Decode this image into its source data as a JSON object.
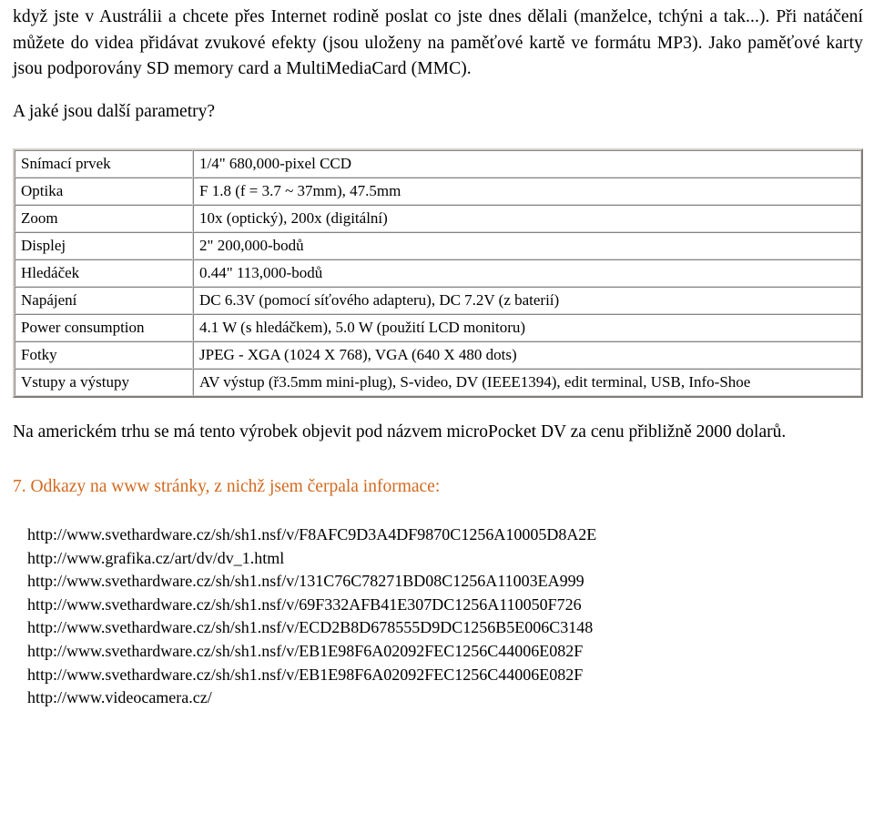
{
  "document": {
    "intro_paragraph": "když jste v Austrálii a chcete přes Internet rodině poslat co jste dnes dělali (manželce, tchýni a tak...). Při natáčení můžete do videa přidávat zvukové efekty (jsou uloženy na paměťové kartě ve formátu MP3). Jako paměťové karty jsou podporovány SD memory card a MultiMediaCard (MMC).",
    "question_line": "A jaké jsou další parametry?",
    "closing_paragraph": "Na americkém trhu se má tento výrobek objevit pod názvem microPocket DV za cenu přibližně 2000 dolarů.",
    "section_heading": "7. Odkazy na www stránky, z nichž jsem čerpala informace:",
    "heading_color": "#d2691e"
  },
  "spec_table": {
    "rows": [
      {
        "label": "Snímací prvek",
        "value": "1/4\" 680,000-pixel CCD"
      },
      {
        "label": "Optika",
        "value": "F 1.8 (f = 3.7 ~ 37mm), 47.5mm"
      },
      {
        "label": "Zoom",
        "value": "10x (optický), 200x (digitální)"
      },
      {
        "label": "Displej",
        "value": "2\" 200,000-bodů"
      },
      {
        "label": "Hledáček",
        "value": "0.44\" 113,000-bodů"
      },
      {
        "label": "Napájení",
        "value": "DC 6.3V (pomocí síťového adapteru), DC 7.2V (z baterií)"
      },
      {
        "label": "Power consumption",
        "value": "4.1 W (s hledáčkem), 5.0 W (použití LCD monitoru)"
      },
      {
        "label": "Fotky",
        "value": "JPEG - XGA (1024 X 768), VGA (640 X 480 dots)"
      },
      {
        "label": "Vstupy a výstupy",
        "value": "AV výstup (ř3.5mm mini-plug), S-video, DV (IEEE1394), edit terminal, USB, Info-Shoe"
      }
    ]
  },
  "links": [
    "http://www.svethardware.cz/sh/sh1.nsf/v/F8AFC9D3A4DF9870C1256A10005D8A2E",
    "http://www.grafika.cz/art/dv/dv_1.html",
    "http://www.svethardware.cz/sh/sh1.nsf/v/131C76C78271BD08C1256A11003EA999",
    "http://www.svethardware.cz/sh/sh1.nsf/v/69F332AFB41E307DC1256A110050F726",
    "http://www.svethardware.cz/sh/sh1.nsf/v/ECD2B8D678555D9DC1256B5E006C3148",
    "http://www.svethardware.cz/sh/sh1.nsf/v/EB1E98F6A02092FEC1256C44006E082F",
    "http://www.svethardware.cz/sh/sh1.nsf/v/EB1E98F6A02092FEC1256C44006E082F",
    "http://www.videocamera.cz/"
  ]
}
